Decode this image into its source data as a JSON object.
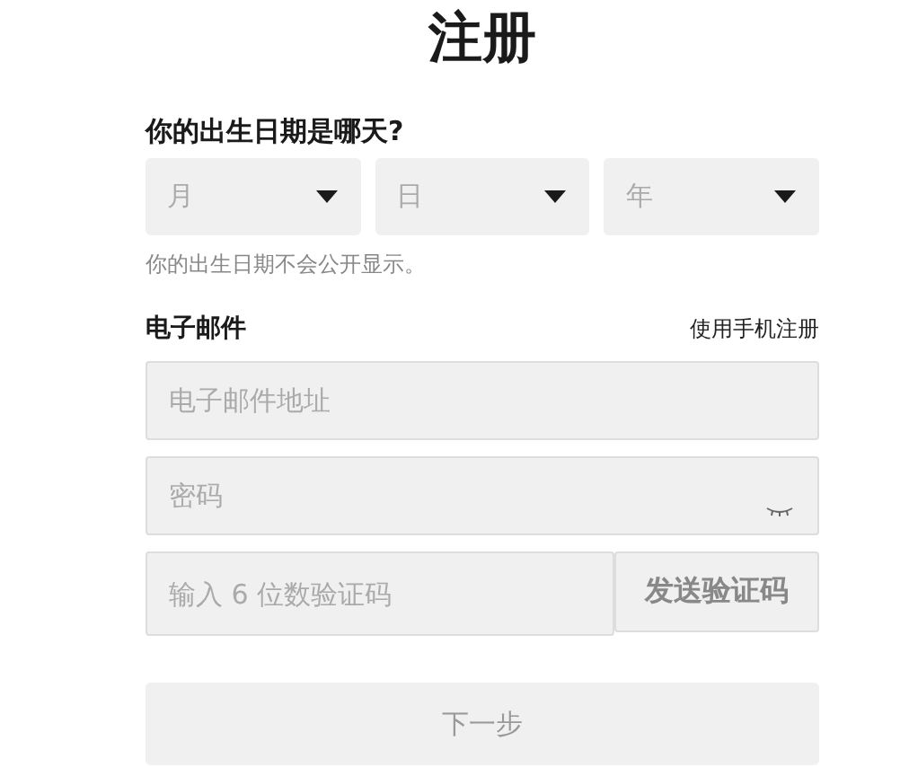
{
  "title": "注册",
  "birthday": {
    "label": "你的出生日期是哪天?",
    "dropdowns": [
      {
        "placeholder": "月"
      },
      {
        "placeholder": "日"
      },
      {
        "placeholder": "年"
      }
    ],
    "hint": "你的出生日期不会公开显示。"
  },
  "email": {
    "label": "电子邮件",
    "switch_link": "使用手机注册",
    "address": {
      "placeholder": "电子邮件地址"
    },
    "password": {
      "placeholder": "密码"
    },
    "code": {
      "placeholder": "输入 6 位数验证码"
    },
    "send_button": "发送验证码"
  },
  "next_button": {
    "label": "下一步",
    "disabled": true
  }
}
